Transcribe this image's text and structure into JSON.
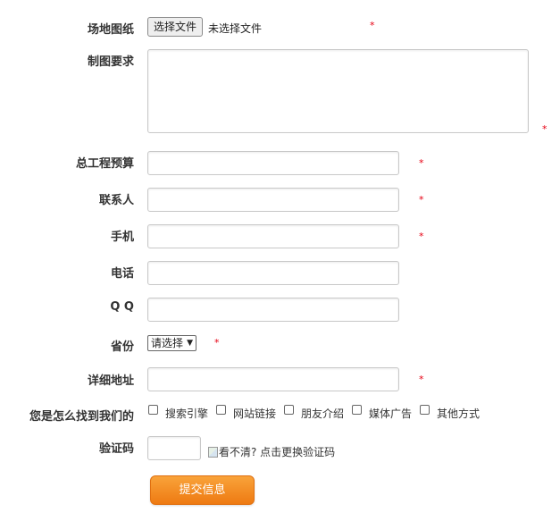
{
  "form": {
    "site_drawing": {
      "label": "场地图纸",
      "button": "选择文件",
      "status": "未选择文件",
      "required": "*"
    },
    "drawing_req": {
      "label": "制图要求",
      "value": "",
      "required": "*"
    },
    "budget": {
      "label": "总工程预算",
      "value": "",
      "required": "*"
    },
    "contact": {
      "label": "联系人",
      "value": "",
      "required": "*"
    },
    "mobile": {
      "label": "手机",
      "value": "",
      "required": "*"
    },
    "phone": {
      "label": "电话",
      "value": ""
    },
    "qq": {
      "label": "Q Q",
      "value": ""
    },
    "province": {
      "label": "省份",
      "selected": "请选择",
      "required": "*"
    },
    "address": {
      "label": "详细地址",
      "value": "",
      "required": "*"
    },
    "source": {
      "label": "您是怎么找到我们的",
      "options": [
        "搜索引擎",
        "网站链接",
        "朋友介绍",
        "媒体广告",
        "其他方式"
      ]
    },
    "captcha": {
      "label": "验证码",
      "value": "",
      "image_alt": "看不清? 点击更换验证码"
    },
    "submit_label": "提交信息"
  }
}
